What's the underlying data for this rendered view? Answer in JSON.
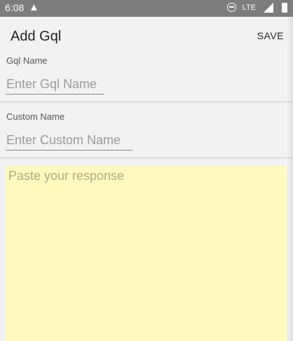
{
  "status_bar": {
    "time": "6:08",
    "alert_icon": "warning-icon",
    "network": "LTE"
  },
  "app_bar": {
    "title": "Add Gql",
    "save_label": "SAVE"
  },
  "form": {
    "gql_name": {
      "label": "Gql Name",
      "placeholder": "Enter Gql Name",
      "value": ""
    },
    "custom_name": {
      "label": "Custom Name",
      "placeholder": "Enter Custom Name",
      "value": ""
    },
    "response": {
      "placeholder": "Paste your response",
      "value": ""
    }
  },
  "colors": {
    "status_bar": "#7d7d7d",
    "background": "#f2f2f2",
    "response_area": "#fff9bf"
  }
}
